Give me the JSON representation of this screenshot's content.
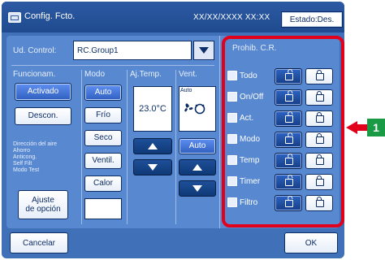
{
  "title": {
    "app": "Config. Fcto.",
    "datetime": "XX/XX/XXXX  XX:XX",
    "status_btn": "Estado:Des."
  },
  "unit": {
    "label": "Ud. Control:",
    "value": "RC.Group1"
  },
  "columns": {
    "funcionam": "Funcionam.",
    "modo": "Modo",
    "ajtemp": "Aj.Temp.",
    "vent": "Vent.",
    "prohib": "Prohib. C.R."
  },
  "funcionam": {
    "activado": "Activado",
    "descon": "Descon."
  },
  "side_info": {
    "dir": "Dirección del aire",
    "ahorro": "Ahorro",
    "anticong": "Anticong.",
    "self": "Self Filt",
    "modotest": "Modo Test"
  },
  "ajuste_btn": {
    "line1": "Ajuste",
    "line2": "de opción"
  },
  "modes": {
    "auto": "Auto",
    "frio": "Frío",
    "seco": "Seco",
    "ventil": "Ventil.",
    "calor": "Calor"
  },
  "temp": {
    "value": "23.0°C"
  },
  "vent": {
    "auto_label": "Auto",
    "auto_btn": "Auto"
  },
  "prohib_rows": [
    {
      "label": "Todo"
    },
    {
      "label": "On/Off"
    },
    {
      "label": "Act."
    },
    {
      "label": "Modo"
    },
    {
      "label": "Temp"
    },
    {
      "label": "Timer"
    },
    {
      "label": "Filtro"
    }
  ],
  "bottom": {
    "cancel": "Cancelar",
    "ok": "OK"
  },
  "callout": {
    "number": "1"
  },
  "colors": {
    "accent": "#3f70b8",
    "highlight": "#e3001b",
    "badge": "#1a9a45"
  }
}
